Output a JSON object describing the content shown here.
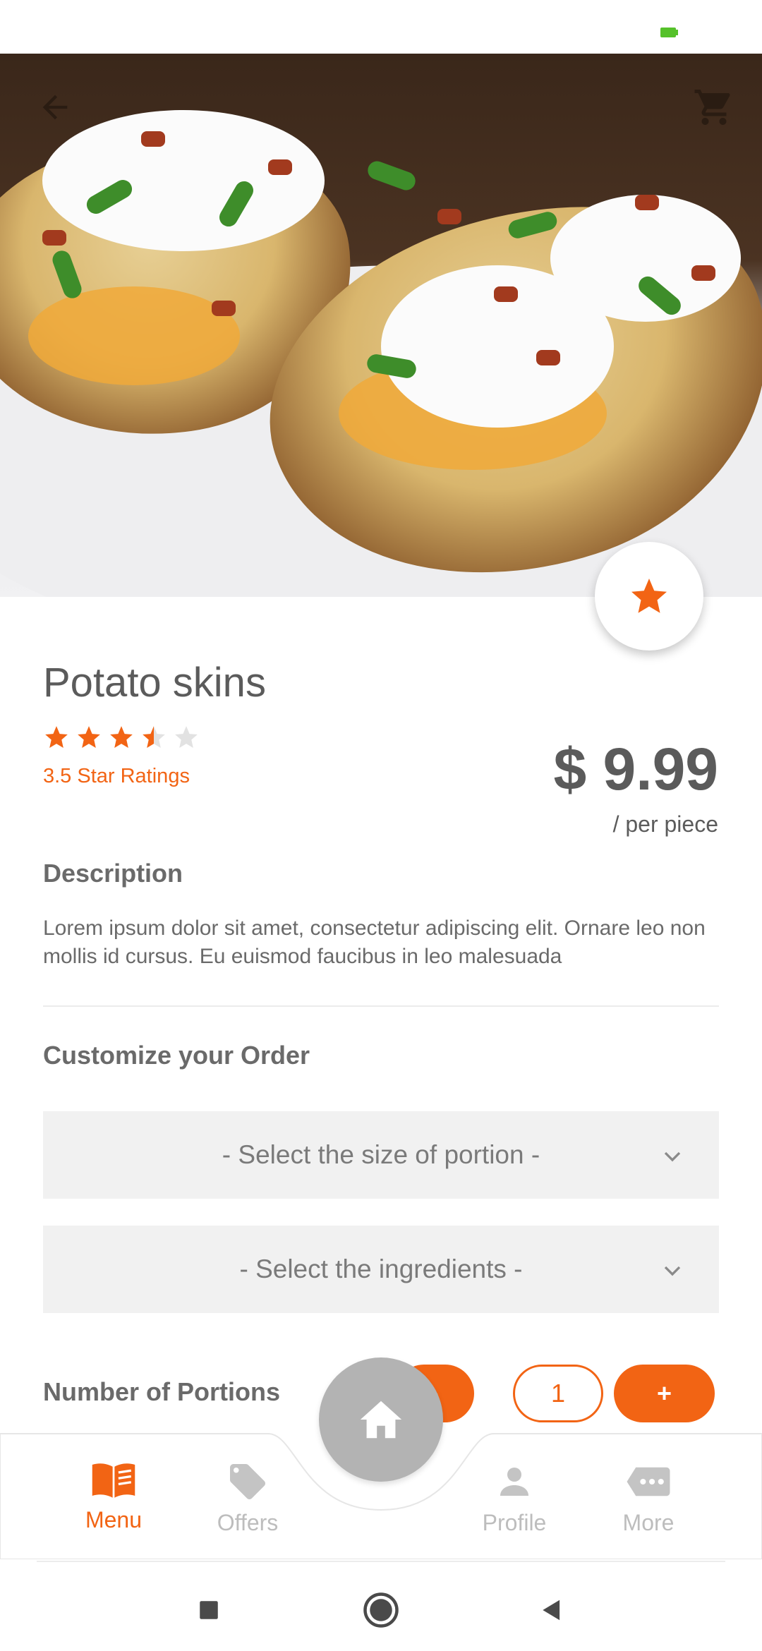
{
  "product": {
    "name": "Potato skins",
    "rating": 3.5,
    "rating_max": 5,
    "rating_label": "3.5 Star Ratings",
    "price": "$ 9.99",
    "price_unit": "/ per piece",
    "image_icon": "loaded-potato-skins-photo"
  },
  "description": {
    "heading": "Description",
    "text": "Lorem ipsum dolor sit amet, consectetur adipiscing elit. Ornare leo non mollis id cursus. Eu euismod faucibus in leo malesuada"
  },
  "customize": {
    "heading": "Customize your Order",
    "size_select": "- Select the size of portion -",
    "ingredients_select": "- Select the ingredients -"
  },
  "portions": {
    "label": "Number of Portions",
    "minus_label": "-",
    "quantity": "1",
    "plus_label": "+"
  },
  "bottom_nav": {
    "items": [
      {
        "label": "Menu",
        "icon": "menu-book-icon",
        "active": true
      },
      {
        "label": "Offers",
        "icon": "tag-icon",
        "active": false
      },
      {
        "label": "Profile",
        "icon": "person-icon",
        "active": false
      },
      {
        "label": "More",
        "icon": "more-dots-icon",
        "active": false
      }
    ],
    "center_icon": "home-icon"
  },
  "colors": {
    "accent": "#f26414",
    "text": "#5b5b5b",
    "inactive": "#bdbdbd",
    "battery": "#55c12a"
  }
}
